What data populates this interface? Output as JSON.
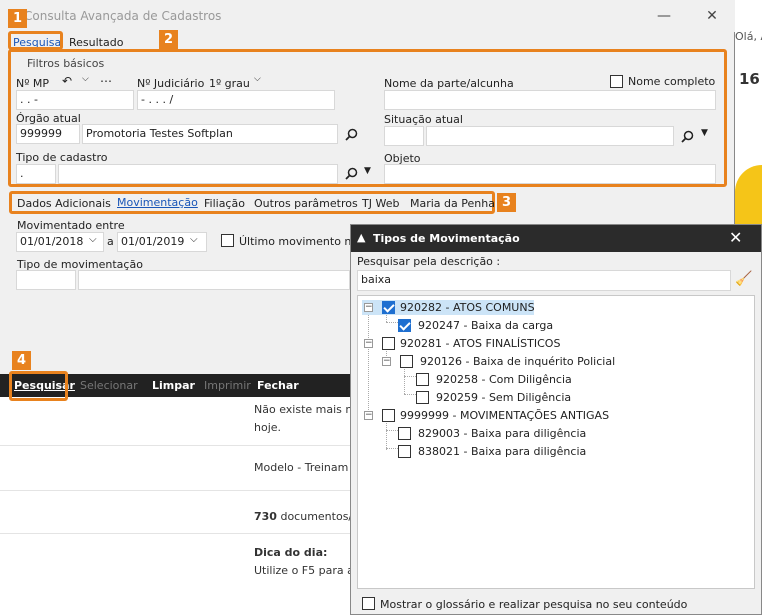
{
  "main_window": {
    "title": "Consulta Avançada de Cadastros",
    "close_glyph": "✕",
    "minimize_glyph": "—",
    "tabs": [
      {
        "label": "Pesquisa"
      },
      {
        "label": "Resultado"
      }
    ],
    "callouts": [
      "1",
      "2",
      "3",
      "4"
    ],
    "filters": {
      "group_label": "Filtros básicos",
      "mp_label": "Nº MP",
      "mp_value": " .     .     -",
      "judicial_label": "Nº Judiciário",
      "instance_label": "1º grau",
      "judicial_value": "-  .   .   .   /",
      "party_label": "Nome da parte/alcunha",
      "full_name_label": "Nome completo",
      "organ_label": "Órgão atual",
      "organ_code": "999999",
      "organ_name": "Promotoria Testes Softplan",
      "status_label": "Situação atual",
      "type_label": "Tipo de cadastro",
      "type_value": ".",
      "object_label": "Objeto"
    },
    "subtabs": [
      {
        "label": "Dados Adicionais"
      },
      {
        "label": "Movimentação"
      },
      {
        "label": "Filiação"
      },
      {
        "label": "Outros parâmetros"
      },
      {
        "label": "TJ Web"
      },
      {
        "label": "Maria da Penha"
      }
    ],
    "movement": {
      "between_label": "Movimentado entre",
      "date_from": "01/01/2018",
      "and_label": "a",
      "date_to": "01/01/2019",
      "last_movement_label": "Último movimento no",
      "type_label": "Tipo de movimentação"
    },
    "toolbar": {
      "search": "Pesquisar",
      "select": "Selecionar",
      "clear": "Limpar",
      "print": "Imprimir",
      "close": "Fechar"
    }
  },
  "background": {
    "right_text_top": "Olá, A",
    "right_text_num": "16",
    "notice_line1": "Não existe mais no",
    "notice_line2": "hoje.",
    "model_text": "Modelo - Treinam",
    "docs_count": "730",
    "docs_text": " documentos/",
    "tip_title": "Dica do dia:",
    "tip_text": "Utilize o F5 para a"
  },
  "dialog": {
    "title": "Tipos de Movimentação",
    "close_glyph": "✕",
    "search_label": "Pesquisar pela descrição :",
    "search_value": "baixa",
    "glossary_label": "Mostrar o glossário e realizar pesquisa no seu conteúdo",
    "tree": [
      {
        "label": "920282 - ATOS COMUNS",
        "checked": true
      },
      {
        "label": "920247 - Baixa da carga",
        "checked": true
      },
      {
        "label": "920281 - ATOS FINALÍSTICOS",
        "checked": false
      },
      {
        "label": "920126 - Baixa de inquérito Policial",
        "checked": false
      },
      {
        "label": "920258 - Com Diligência",
        "checked": false
      },
      {
        "label": "920259 - Sem Diligência",
        "checked": false
      },
      {
        "label": "9999999 - MOVIMENTAÇÕES ANTIGAS",
        "checked": false
      },
      {
        "label": "829003 - Baixa para diligência",
        "checked": false
      },
      {
        "label": "838021 - Baixa para diligência",
        "checked": false
      }
    ]
  },
  "colors": {
    "accent": "#e8821e",
    "link": "#1a56b8",
    "selected": "#cce4f7"
  }
}
